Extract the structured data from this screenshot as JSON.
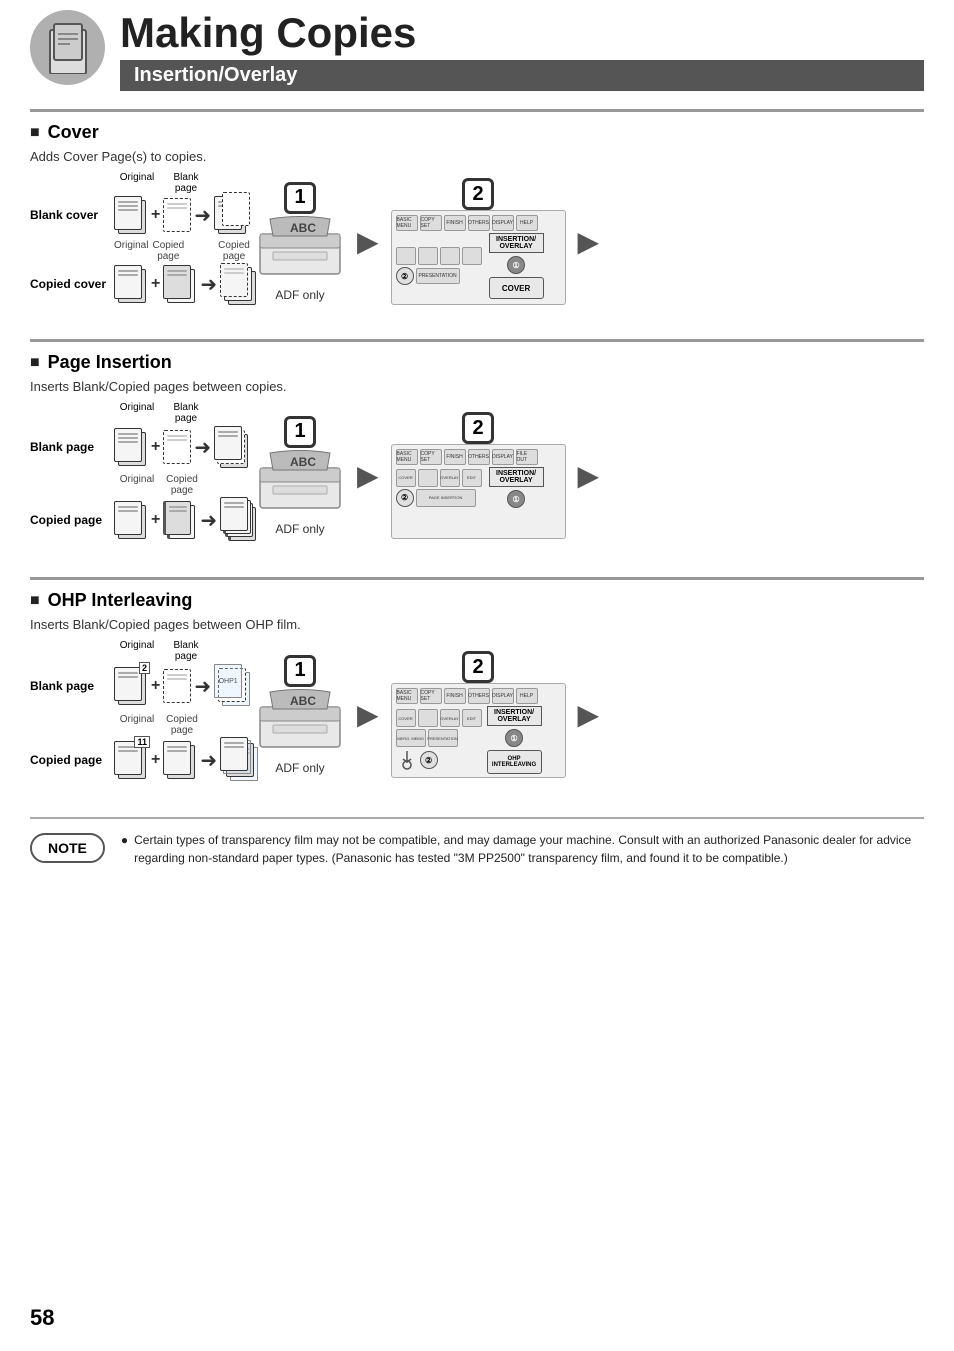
{
  "header": {
    "title": "Making Copies",
    "subtitle": "Insertion/Overlay"
  },
  "cover_section": {
    "title": "Cover",
    "description": "Adds Cover Page(s) to copies.",
    "blank_cover_label": "Blank cover",
    "copied_cover_label": "Copied cover",
    "original_label": "Original",
    "blank_page_label": "Blank\npage",
    "copied_page_label": "Copied\npage",
    "step1_label": "1",
    "step1_desc": "ADF only",
    "step2_label": "2",
    "panel_button": "COVER",
    "panel_section": "INSERTION/\nOVERLAY"
  },
  "page_insertion_section": {
    "title": "Page Insertion",
    "description": "Inserts Blank/Copied pages between copies.",
    "blank_page_label": "Blank page",
    "copied_page_label": "Copied page",
    "original_label": "Original",
    "blank_page_col_label": "Blank\npage",
    "copied_page_col_label": "Copied\npage",
    "step1_label": "1",
    "step1_desc": "ADF only",
    "step2_label": "2",
    "panel_button": "PAGE\nINSERTION",
    "panel_section": "INSERTION/\nOVERLAY"
  },
  "ohp_section": {
    "title": "OHP Interleaving",
    "description": "Inserts Blank/Copied pages between OHP\nfilm.",
    "blank_page_label": "Blank page",
    "copied_page_label": "Copied page",
    "original_label": "Original",
    "blank_page_col_label": "Blank\npage",
    "copied_page_col_label": "Copied\npage",
    "step1_label": "1",
    "step1_desc": "ADF only",
    "step2_label": "2",
    "panel_button": "OHP\nINTERLEAVING",
    "panel_section": "INSERTION/\nOVERLAY"
  },
  "note": {
    "label": "NOTE",
    "bullet": "●",
    "text": "Certain types of transparency film may not be compatible, and may damage your machine. Consult with an authorized Panasonic dealer for advice regarding non-standard paper types. (Panasonic has tested  \"3M PP2500\" transparency film, and found it to be compatible.)"
  },
  "page_number": "58"
}
